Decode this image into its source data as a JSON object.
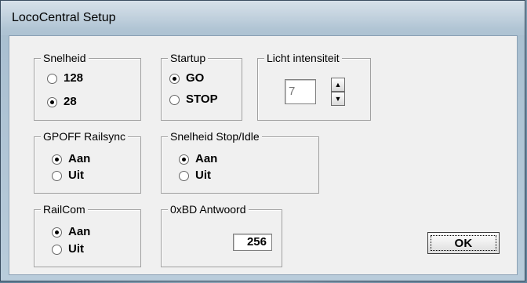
{
  "window": {
    "title": "LocoCentral Setup"
  },
  "groups": {
    "snelheid": {
      "title": "Snelheid",
      "options": [
        {
          "label": "128",
          "selected": false
        },
        {
          "label": "28",
          "selected": true
        }
      ]
    },
    "startup": {
      "title": "Startup",
      "options": [
        {
          "label": "GO",
          "selected": true
        },
        {
          "label": "STOP",
          "selected": false
        }
      ]
    },
    "licht": {
      "title": "Licht intensiteit",
      "value": "7"
    },
    "gpoff": {
      "title": "GPOFF Railsync",
      "options": [
        {
          "label": "Aan",
          "selected": true
        },
        {
          "label": "Uit",
          "selected": false
        }
      ]
    },
    "stopidle": {
      "title": "Snelheid Stop/Idle",
      "options": [
        {
          "label": "Aan",
          "selected": true
        },
        {
          "label": "Uit",
          "selected": false
        }
      ]
    },
    "railcom": {
      "title": "RailCom",
      "options": [
        {
          "label": "Aan",
          "selected": true
        },
        {
          "label": "Uit",
          "selected": false
        }
      ]
    },
    "antwoord": {
      "title": "0xBD Antwoord",
      "value": "256"
    }
  },
  "buttons": {
    "ok": "OK"
  },
  "icons": {
    "spin_up": "arrow-up-icon",
    "spin_down": "arrow-down-icon"
  }
}
